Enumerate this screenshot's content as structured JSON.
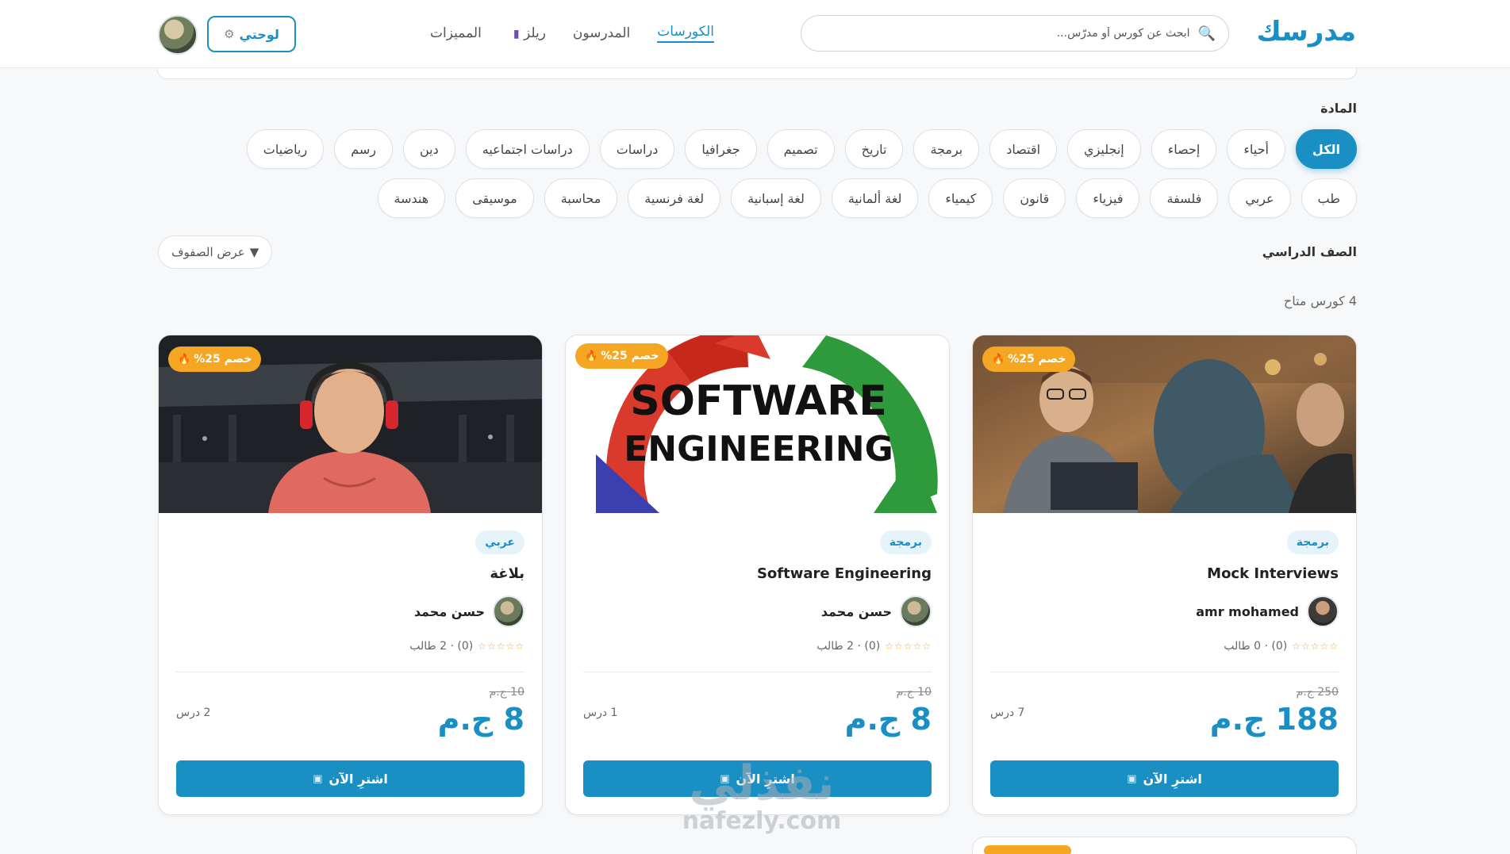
{
  "header": {
    "logo": "مدرسك",
    "search_placeholder": "ابحث عن كورس أو مدرّس...",
    "nav": [
      {
        "label": "الكورسات",
        "active": true
      },
      {
        "label": "المدرسون",
        "active": false
      },
      {
        "label": "ريلز",
        "active": false
      },
      {
        "label": "المميزات",
        "active": false
      }
    ],
    "dashboard_label": "لوحتي"
  },
  "filters": {
    "subject_label": "المادة",
    "subjects_row1": [
      "الكل",
      "أحياء",
      "إحصاء",
      "إنجليزي",
      "اقتصاد",
      "برمجة",
      "تاريخ",
      "تصميم",
      "جغرافيا",
      "دراسات",
      "دراسات اجتماعيه",
      "دين",
      "رسم",
      "رياضيات"
    ],
    "subjects_row2": [
      "طب",
      "عربي",
      "فلسفة",
      "فيزياء",
      "قانون",
      "كيمياء",
      "لغة ألمانية",
      "لغة إسبانية",
      "لغة فرنسية",
      "محاسبة",
      "موسيقى",
      "هندسة"
    ],
    "active_subject": "الكل",
    "grade_label": "الصف الدراسي",
    "rows_toggle": "عرض الصفوف"
  },
  "results": {
    "count_text": "4 كورس متاح"
  },
  "courses": [
    {
      "discount": "خصم 25%",
      "subject": "برمجة",
      "title": "Mock Interviews",
      "teacher": "amr mohamed",
      "rating_text": "(0) · 0 طالب",
      "old_price": "250 ج.م",
      "price": "188 ج.م",
      "lessons": "7 درس",
      "buy_label": "اشترِ الآن"
    },
    {
      "discount": "خصم 25%",
      "subject": "برمجة",
      "title": "Software Engineering",
      "teacher": "حسن محمد",
      "rating_text": "(0) · 2 طالب",
      "old_price": "10 ج.م",
      "price": "8 ج.م",
      "lessons": "1 درس",
      "buy_label": "اشترِ الآن",
      "thumb_text_1": "SOFTWARE",
      "thumb_text_2": "ENGINEERING"
    },
    {
      "discount": "خصم 25%",
      "subject": "عربي",
      "title": "بلاغة",
      "teacher": "حسن محمد",
      "rating_text": "(0) · 2 طالب",
      "old_price": "10 ج.م",
      "price": "8 ج.م",
      "lessons": "2 درس",
      "buy_label": "اشترِ الآن"
    }
  ],
  "watermark": {
    "main": "نفذلي",
    "sub": "nafezly.com"
  },
  "colors": {
    "accent": "#1a8fc4",
    "discount": "#f5a623",
    "background": "#f6f8fa"
  },
  "icons": {
    "search": "search-icon",
    "gear": "gear-icon",
    "reels": "clapperboard-icon",
    "fire": "fire-icon",
    "card": "credit-card-icon",
    "star": "star-icon"
  }
}
